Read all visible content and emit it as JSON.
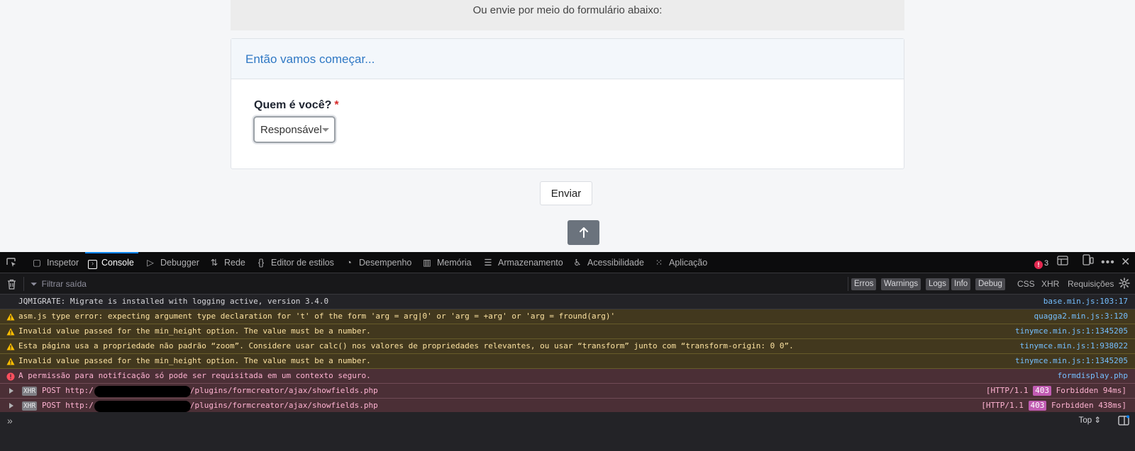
{
  "page": {
    "intro_text": "Ou envie por meio do formulário abaixo:",
    "card_header": "Então vamos começar...",
    "field_label": "Quem é você?",
    "required_marker": "*",
    "select_value": "Responsável",
    "submit_label": "Enviar",
    "scroll_top_icon": "arrow-up-icon"
  },
  "devtools": {
    "tabs": [
      {
        "label": "Inspetor",
        "icon": "inspector-icon"
      },
      {
        "label": "Console",
        "icon": "console-icon"
      },
      {
        "label": "Debugger",
        "icon": "debugger-icon"
      },
      {
        "label": "Rede",
        "icon": "network-icon"
      },
      {
        "label": "Editor de estilos",
        "icon": "style-editor-icon"
      },
      {
        "label": "Desempenho",
        "icon": "performance-icon"
      },
      {
        "label": "Memória",
        "icon": "memory-icon"
      },
      {
        "label": "Armazenamento",
        "icon": "storage-icon"
      },
      {
        "label": "Acessibilidade",
        "icon": "accessibility-icon"
      },
      {
        "label": "Aplicação",
        "icon": "application-icon"
      }
    ],
    "error_count": "3",
    "filter_placeholder": "Filtrar saída",
    "levels": [
      "Erros",
      "Warnings",
      "Logs",
      "Info",
      "Debug"
    ],
    "net_filters": [
      "CSS",
      "XHR",
      "Requisições"
    ],
    "messages": [
      {
        "type": "info",
        "text": "JQMIGRATE: Migrate is installed with logging active, version 3.4.0",
        "source": "base.min.js:103:17"
      },
      {
        "type": "warn",
        "text": "asm.js type error: expecting argument type declaration for 't' of the form 'arg = arg|0' or 'arg = +arg' or 'arg = fround(arg)'",
        "source": "quagga2.min.js:3:120"
      },
      {
        "type": "warn",
        "text": "Invalid value passed for the min_height option. The value must be a number.",
        "source": "tinymce.min.js:1:1345205"
      },
      {
        "type": "warn",
        "text": "Esta página usa a propriedade não padrão “zoom”. Considere usar calc() nos valores de propriedades relevantes, ou usar “transform” junto com “transform-origin: 0 0”.",
        "source": "tinymce.min.js:1:938022"
      },
      {
        "type": "warn",
        "text": "Invalid value passed for the min_height option. The value must be a number.",
        "source": "tinymce.min.js:1:1345205"
      },
      {
        "type": "error",
        "text": "A permissão para notificação só pode ser requisitada em um contexto seguro.",
        "source": "formdisplay.php"
      }
    ],
    "xhr": [
      {
        "badge": "XHR",
        "method_url": "POST http:/",
        "path": "/plugins/formcreator/ajax/showfields.php",
        "proto": "[HTTP/1.1",
        "code": "403",
        "status": "Forbidden 94ms]"
      },
      {
        "badge": "XHR",
        "method_url": "POST http:/",
        "path": "/plugins/formcreator/ajax/showfields.php",
        "proto": "[HTTP/1.1",
        "code": "403",
        "status": "Forbidden 438ms]"
      }
    ],
    "prompt_chevron": "»",
    "context_selector": "Top"
  }
}
